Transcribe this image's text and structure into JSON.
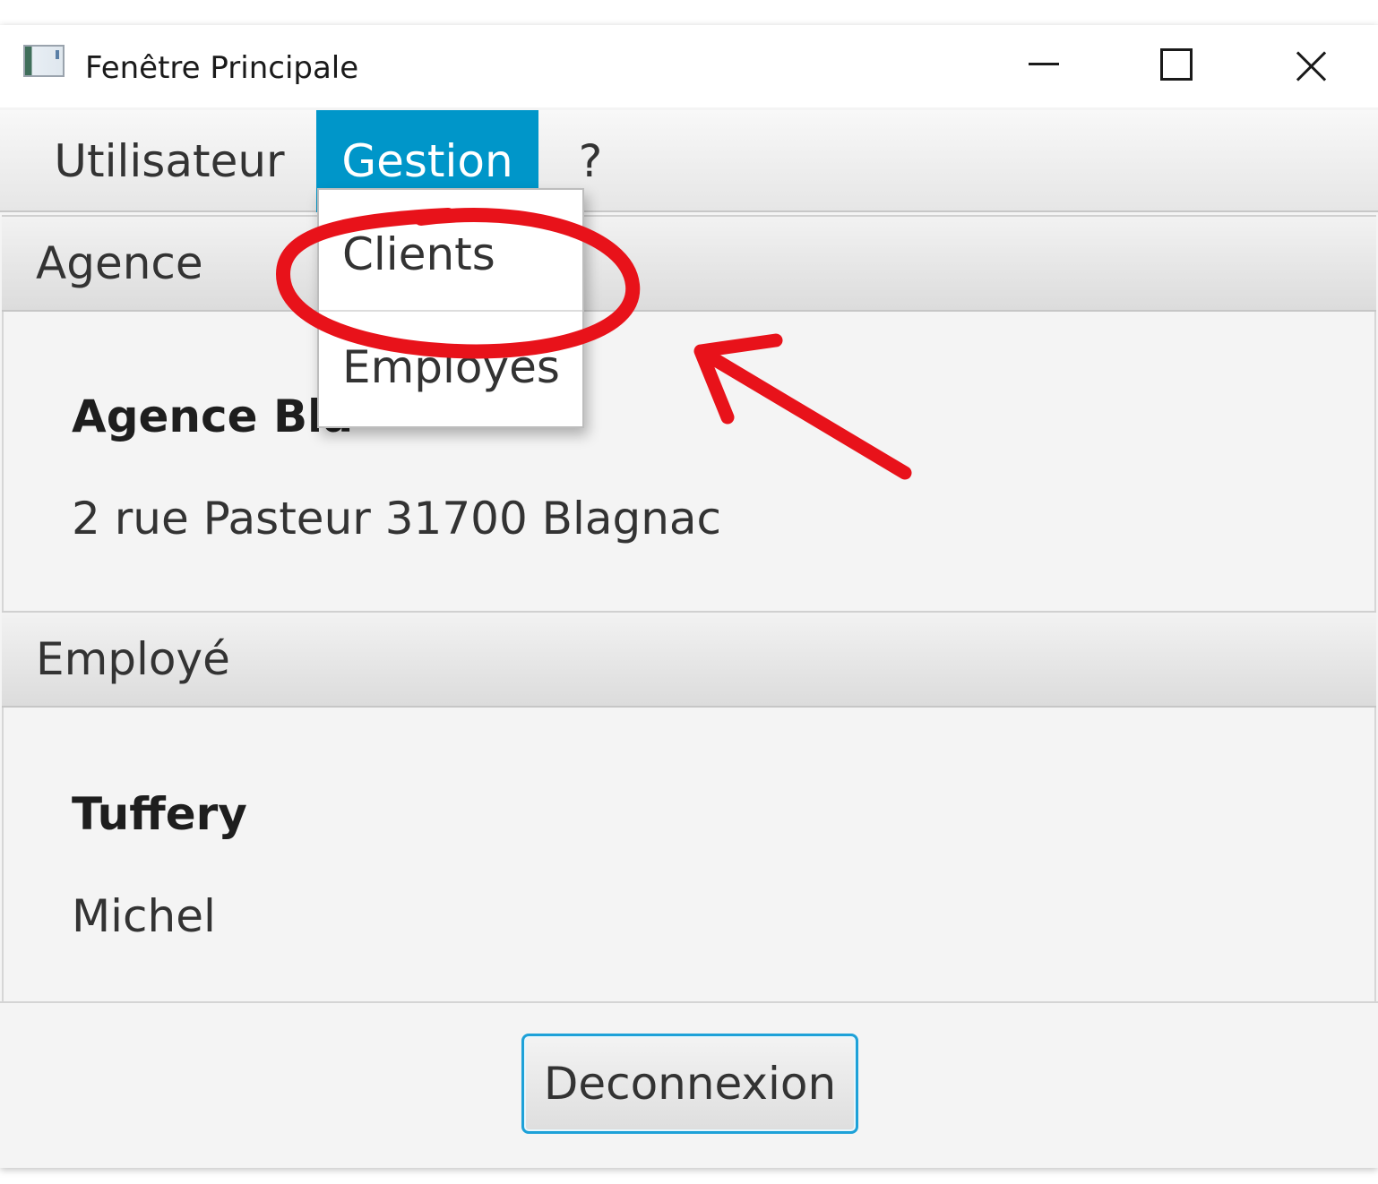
{
  "window": {
    "title": "Fenêtre Principale"
  },
  "menubar": {
    "items": [
      {
        "label": "Utilisateur"
      },
      {
        "label": "Gestion"
      },
      {
        "label": "?"
      }
    ],
    "active_color": "#0096c9"
  },
  "dropdown": {
    "items": [
      {
        "label": "Clients"
      },
      {
        "label": "Employés"
      }
    ]
  },
  "agence_pane": {
    "title": "Agence",
    "name": "Agence Bla",
    "address": "2 rue Pasteur 31700 Blagnac"
  },
  "employe_pane": {
    "title": "Employé",
    "nom": "Tuffery",
    "prenom": "Michel"
  },
  "footer": {
    "deconnexion_label": "Deconnexion"
  },
  "annotation": {
    "color": "#e8121a",
    "shapes": [
      "circle-icon",
      "arrow-icon"
    ]
  }
}
